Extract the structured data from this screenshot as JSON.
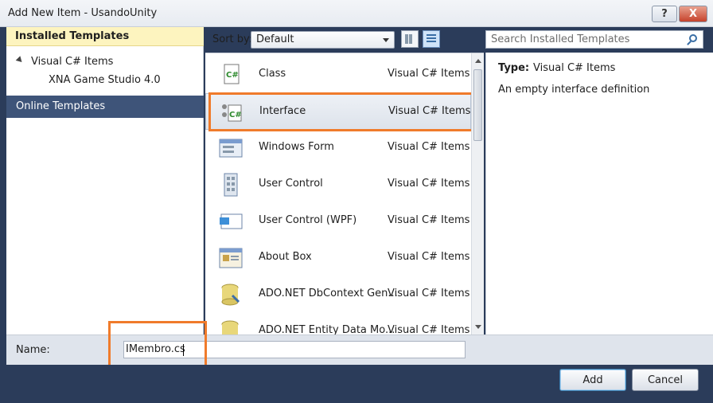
{
  "window": {
    "title": "Add New Item - UsandoUnity",
    "help_label": "?",
    "close_label": "X"
  },
  "left_panel": {
    "installed_header": "Installed Templates",
    "tree": [
      {
        "label": "Visual C# Items"
      },
      {
        "label": "XNA Game Studio 4.0"
      }
    ],
    "online_header": "Online Templates"
  },
  "toolbar": {
    "sort_label": "Sort by:",
    "sort_value": "Default",
    "search_placeholder": "Search Installed Templates"
  },
  "templates": [
    {
      "name": "Class",
      "category": "Visual C# Items",
      "icon": "class-icon"
    },
    {
      "name": "Interface",
      "category": "Visual C# Items",
      "icon": "interface-icon"
    },
    {
      "name": "Windows Form",
      "category": "Visual C# Items",
      "icon": "windows-form-icon"
    },
    {
      "name": "User Control",
      "category": "Visual C# Items",
      "icon": "user-control-icon"
    },
    {
      "name": "User Control (WPF)",
      "category": "Visual C# Items",
      "icon": "user-control-wpf-icon"
    },
    {
      "name": "About Box",
      "category": "Visual C# Items",
      "icon": "about-box-icon"
    },
    {
      "name": "ADO.NET DbContext Gen...",
      "category": "Visual C# Items",
      "icon": "ado-net-icon"
    },
    {
      "name": "ADO.NET Entity Data Mo...",
      "category": "Visual C# Items",
      "icon": "ado-net-entity-icon"
    }
  ],
  "details": {
    "type_label": "Type:",
    "type_value": "Visual C# Items",
    "description": "An empty interface definition"
  },
  "name_field": {
    "label": "Name:",
    "value": "IMembro.cs"
  },
  "buttons": {
    "add": "Add",
    "cancel": "Cancel"
  }
}
